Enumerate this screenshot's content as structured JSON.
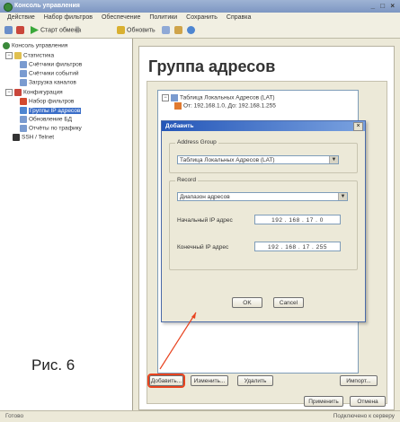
{
  "window": {
    "title": "Консоль управления",
    "controls": "_ □ ×"
  },
  "menu": [
    "Действие",
    "Набор фильтров",
    "Обеспечение",
    "Политики",
    "Сохранить",
    "Справка"
  ],
  "toolbar": {
    "start_label": "Старт обмена",
    "update_label": "Обновить"
  },
  "tree": {
    "root": "Консоль управления",
    "statistics": "Статистика",
    "filter_counters": "Счётчики фильтров",
    "event_counters": "Счётчики событий",
    "counters_all": "Загрузка каналов",
    "config": "Конфигурация",
    "filter_set": "Набор фильтров",
    "ip_groups": "Группы IP адресов",
    "db_update": "Обновление БД",
    "traffic_reports": "Отчёты по трафику",
    "ssh": "SSH / Telnet"
  },
  "figure_caption": "Рис. 6",
  "main": {
    "page_title": "Группа адресов",
    "list": {
      "group_item": "Таблица Локальных Адресов (LAT)",
      "range_item": "От: 192.168.1.0, До: 192.168.1.255"
    },
    "buttons": {
      "add": "Добавить...",
      "edit": "Изменить...",
      "delete": "Удалить",
      "import": "Импорт...",
      "apply": "Применить",
      "cancel": "Отмена"
    }
  },
  "dialog": {
    "title": "Добавить",
    "close": "×",
    "address_group_legend": "Address Group",
    "address_group_value": "Таблица Локальных Адресов (LAT)",
    "record_legend": "Record",
    "record_value": "Диапазон адресов",
    "start_ip_label": "Начальный IP адрес",
    "start_ip_value": "192 . 168 . 17 . 0",
    "end_ip_label": "Конечный IP адрес",
    "end_ip_value": "192 . 168 . 17 . 255",
    "ok": "OK",
    "cancel": "Cancel"
  },
  "status": {
    "left": "Готово",
    "right": "Подключено к серверу"
  },
  "colors": {
    "accent": "#2456b8",
    "highlight": "#e8431f"
  }
}
